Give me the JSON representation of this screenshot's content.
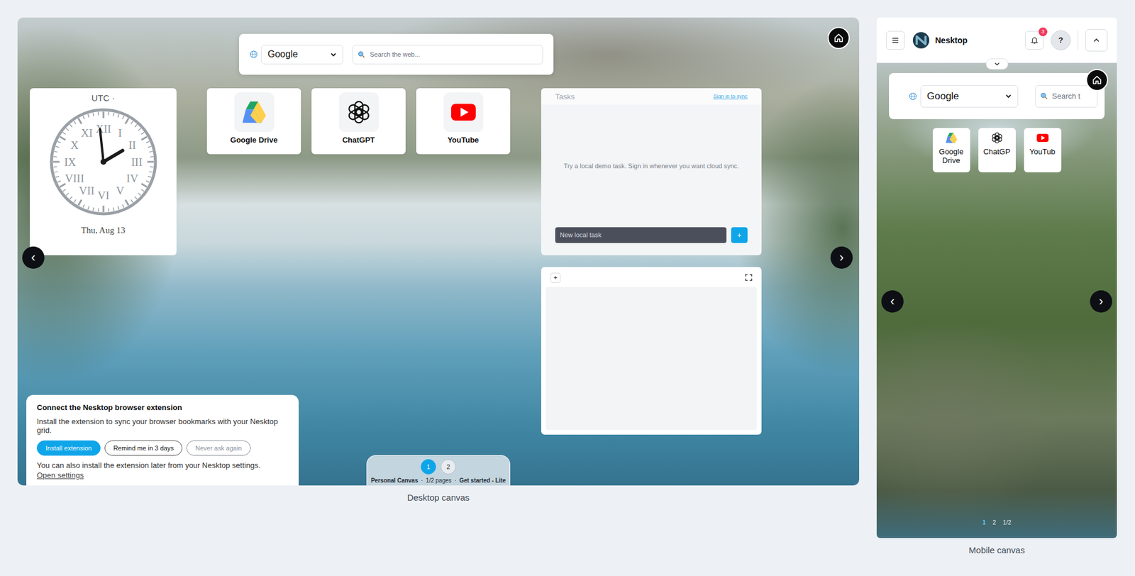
{
  "desktop": {
    "label": "Desktop canvas",
    "search": {
      "engine": "Google",
      "placeholder": "Search the web..."
    },
    "clock": {
      "zone": "UTC ·",
      "date": "Thu, Aug 13",
      "numerals": [
        "XII",
        "I",
        "II",
        "III",
        "IV",
        "V",
        "VI",
        "VII",
        "VIII",
        "IX",
        "X",
        "XI"
      ],
      "time": {
        "hours": 1,
        "minutes": 59
      }
    },
    "tiles": [
      {
        "label": "Google Drive",
        "kind": "drive"
      },
      {
        "label": "ChatGPT",
        "kind": "chatgpt"
      },
      {
        "label": "YouTube",
        "kind": "youtube"
      }
    ],
    "tasks": {
      "title": "Tasks",
      "sync": "Sign in to sync",
      "empty": "Try a local demo task. Sign in whenever you want cloud sync.",
      "placeholder": "New local task",
      "add": "+"
    },
    "notes": {
      "add": "+"
    },
    "nav": {
      "prev": "‹",
      "next": "›"
    },
    "prompt": {
      "title": "Connect the Nesktop browser extension",
      "body": "Install the extension to sync your browser bookmarks with your Nesktop grid.",
      "buttons": [
        {
          "label": "Install extension",
          "kind": "primary"
        },
        {
          "label": "Remind me in 3 days",
          "kind": "outline"
        },
        {
          "label": "Never ask again",
          "kind": "muted"
        }
      ],
      "note": "You can also install the extension later from your Nesktop settings.",
      "link": "Open settings"
    },
    "pager": {
      "pages": [
        {
          "label": "1",
          "selected": true
        },
        {
          "label": "2",
          "selected": false
        }
      ],
      "name": "Personal Canvas",
      "sep": "·",
      "count": "1/2 pages",
      "plan": "Get started - Lite"
    }
  },
  "mobile": {
    "label": "Mobile canvas",
    "header": {
      "brand": "Nesktop",
      "badge": "3",
      "help": "?"
    },
    "search": {
      "engine": "Google",
      "placeholder": "Search t"
    },
    "tiles": [
      {
        "label": "Google Drive",
        "kind": "drive"
      },
      {
        "label": "ChatGP",
        "kind": "chatgpt"
      },
      {
        "label": "YouTub",
        "kind": "youtube"
      }
    ],
    "nav": {
      "prev": "‹",
      "next": "›"
    },
    "pager": {
      "pages": [
        {
          "label": "1",
          "selected": true
        },
        {
          "label": "2",
          "selected": false
        }
      ],
      "count": "1/2"
    }
  }
}
